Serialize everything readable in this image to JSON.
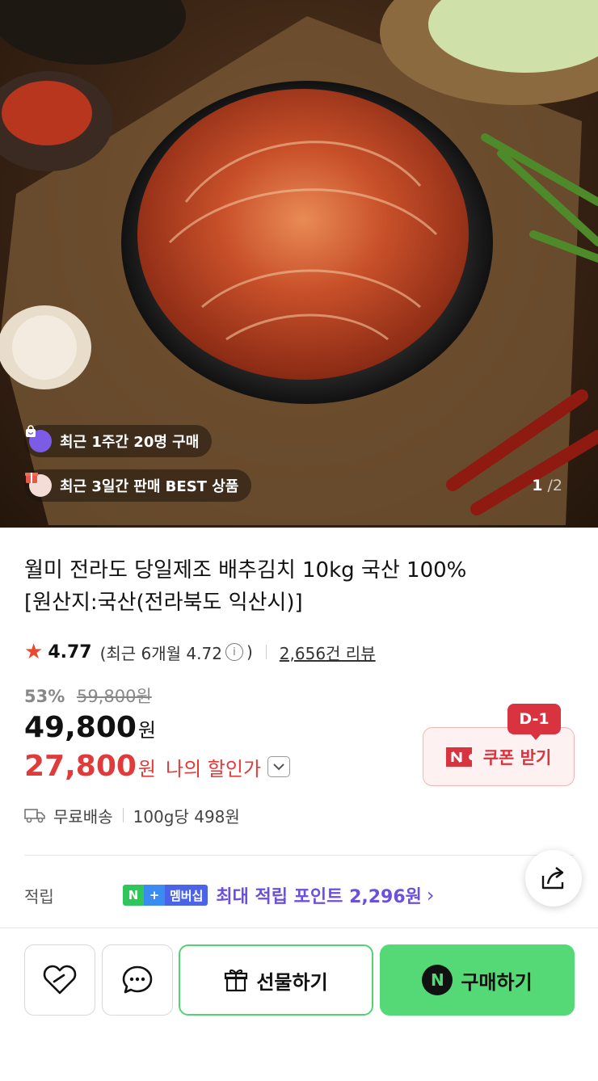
{
  "hero": {
    "badge_recent_buyers": "최근 1주간 20명 구매",
    "badge_best": "최근 3일간 판매 BEST 상품",
    "image_index_current": "1",
    "image_index_separator": "/",
    "image_index_total": "2"
  },
  "product": {
    "title_line1": "월미 전라도 당일제조 배추김치 10kg 국산 100%",
    "title_line2": "[원산지:국산(전라북도 익산시)]"
  },
  "rating": {
    "score": "4.77",
    "recent_prefix": "(최근 6개월 4.72",
    "recent_suffix": ")",
    "info_glyph": "i",
    "review_count": "2,656건 리뷰"
  },
  "pricing": {
    "discount_rate": "53%",
    "original_price": "59,800원",
    "sale_price": "49,800",
    "won": "원",
    "my_price": "27,800",
    "my_price_label": "나의 할인가"
  },
  "coupon": {
    "dday": "D-1",
    "label": "쿠폰 받기"
  },
  "shipping": {
    "delivery": "무료배송",
    "unit_price": "100g당 498원"
  },
  "points": {
    "label": "적립",
    "badge_n": "N",
    "badge_plus": "+",
    "badge_membership": "멤버십",
    "text": "최대 적립 포인트 2,296원"
  },
  "actions": {
    "gift_label": "선물하기",
    "buy_label": "구매하기",
    "buy_icon_letter": "N"
  },
  "colors": {
    "accent_red": "#e03a3a",
    "naver_green": "#55d976",
    "points_purple": "#6a4fe0"
  }
}
